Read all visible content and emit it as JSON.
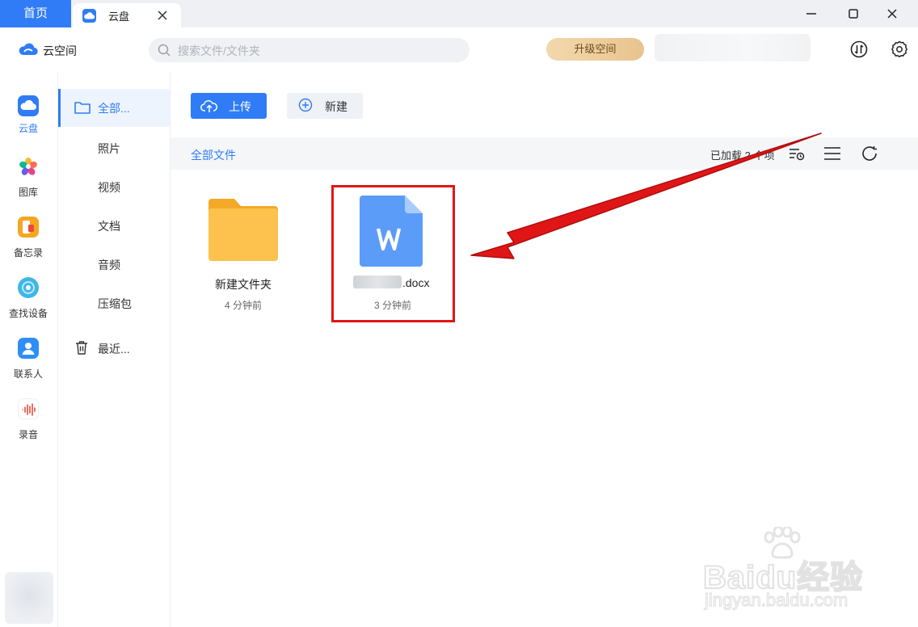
{
  "window": {
    "home_tab": "首页",
    "active_tab": "云盘"
  },
  "header": {
    "brand": "云空间",
    "search_placeholder": "搜索文件/文件夹",
    "upgrade_button": "升级空间"
  },
  "rail": {
    "items": [
      {
        "label": "云盘",
        "icon": "cloud-drive-icon",
        "active": true
      },
      {
        "label": "图库",
        "icon": "gallery-icon"
      },
      {
        "label": "备忘录",
        "icon": "notes-icon"
      },
      {
        "label": "查找设备",
        "icon": "find-device-icon"
      },
      {
        "label": "联系人",
        "icon": "contacts-icon"
      },
      {
        "label": "录音",
        "icon": "recorder-icon"
      }
    ]
  },
  "categories": {
    "all": "全部...",
    "photos": "照片",
    "video": "视频",
    "docs": "文档",
    "audio": "音频",
    "archives": "压缩包",
    "recent": "最近..."
  },
  "toolbar": {
    "upload": "上传",
    "new": "新建"
  },
  "listing": {
    "breadcrumb": "全部文件",
    "loaded_count": "已加载 2 个项"
  },
  "files": [
    {
      "name": "新建文件夹",
      "time": "4 分钟前",
      "type": "folder"
    },
    {
      "name_suffix": ".docx",
      "time": "3 分钟前",
      "type": "word-document"
    }
  ],
  "watermark": {
    "brand": "Baidu经验",
    "url": "jingyan.baidu.com"
  },
  "colors": {
    "accent": "#2f7cf6",
    "annotation_red": "#e01616",
    "folder": "#fcc24d"
  }
}
